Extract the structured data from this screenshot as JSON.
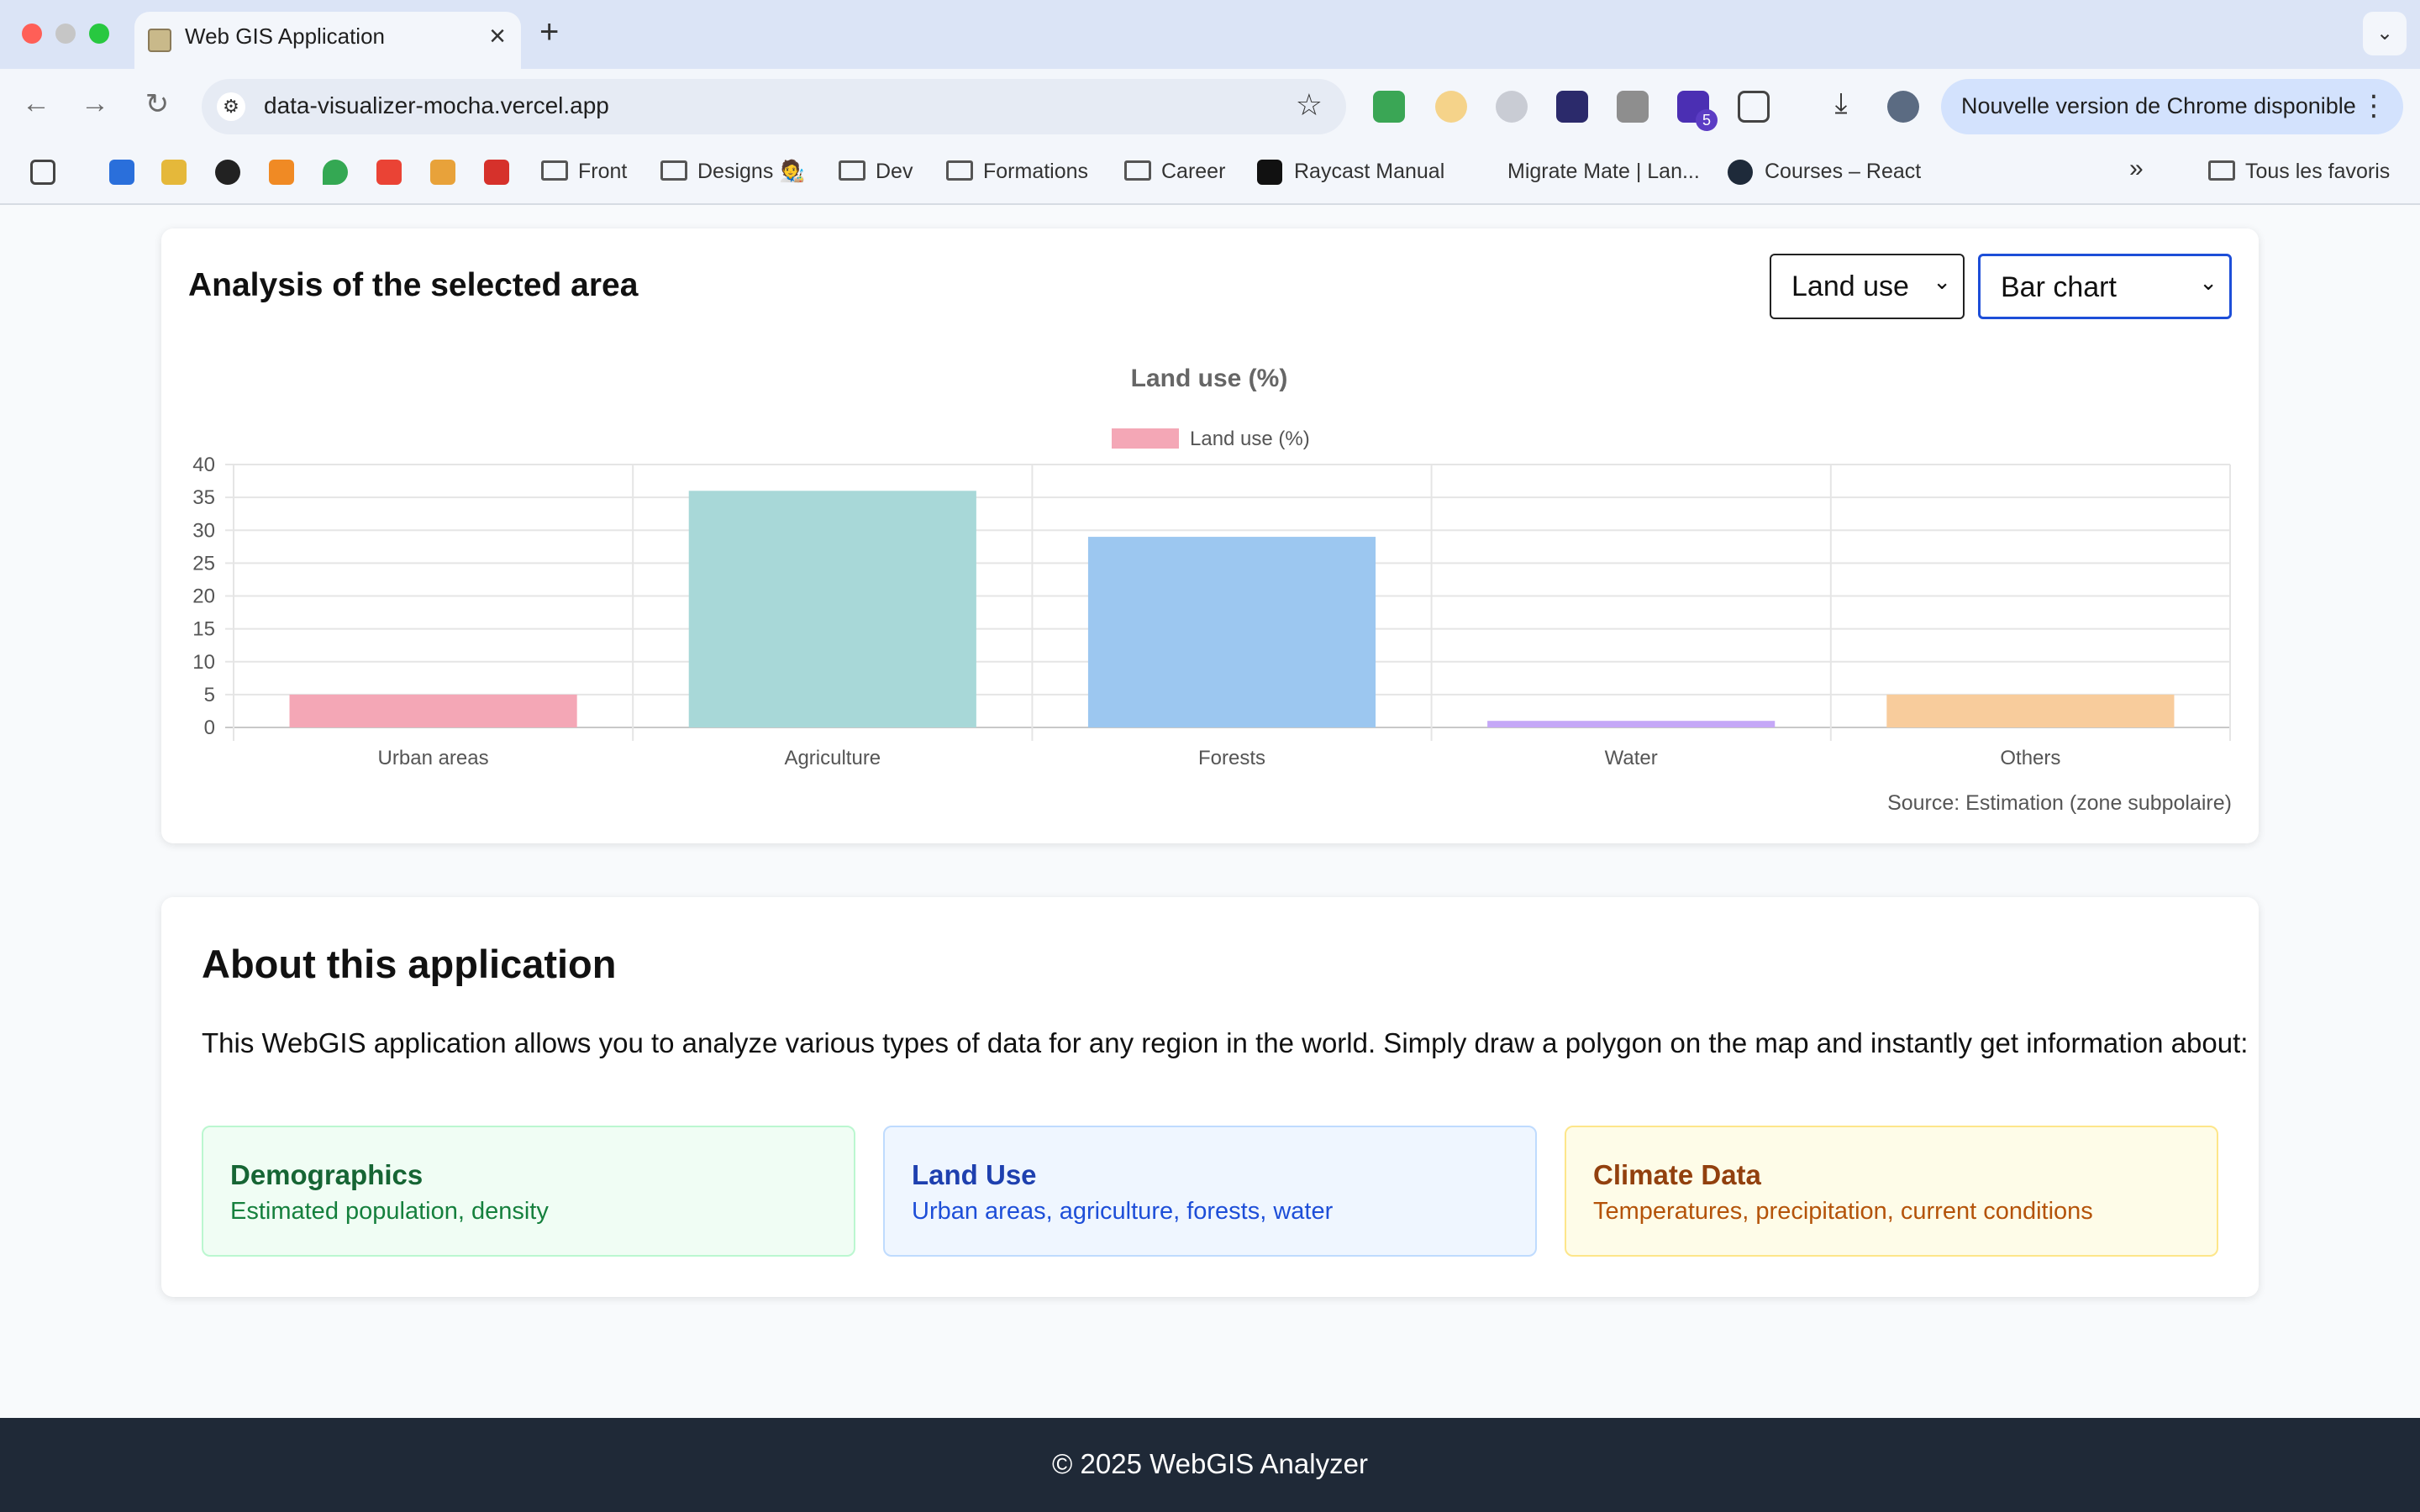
{
  "browser": {
    "tab_title": "Web GIS Application",
    "url": "data-visualizer-mocha.vercel.app",
    "update_label": "Nouvelle version de Chrome disponible",
    "extension_badge": "5",
    "bookmarks": [
      {
        "label": "Front"
      },
      {
        "label": "Designs 🧑‍🎨"
      },
      {
        "label": "Dev"
      },
      {
        "label": "Formations"
      },
      {
        "label": "Career"
      },
      {
        "label": "Raycast Manual"
      },
      {
        "label": "Migrate Mate | Lan..."
      },
      {
        "label": "Courses – React"
      }
    ],
    "all_bookmarks": "Tous les favoris"
  },
  "analysis": {
    "title": "Analysis of the selected area",
    "data_select": "Land use",
    "chart_select": "Bar chart",
    "source": "Source: Estimation (zone subpolaire)"
  },
  "chart_data": {
    "type": "bar",
    "title": "Land use (%)",
    "categories": [
      "Urban areas",
      "Agriculture",
      "Forests",
      "Water",
      "Others"
    ],
    "series": [
      {
        "name": "Land use (%)",
        "values": [
          5,
          36,
          29,
          1,
          5
        ]
      }
    ],
    "colors": [
      "#f4a7b6",
      "#a8d8d8",
      "#9cc7f0",
      "#c5a8f7",
      "#f8cc9c"
    ],
    "yticks": [
      0,
      5,
      10,
      15,
      20,
      25,
      30,
      35,
      40
    ],
    "ylim": [
      0,
      40
    ],
    "legend": "top",
    "grid": true
  },
  "about": {
    "title": "About this application",
    "description": "This WebGIS application allows you to analyze various types of data for any region in the world. Simply draw a polygon on the map and instantly get information about:",
    "features": [
      {
        "title": "Demographics",
        "text": "Estimated population, density"
      },
      {
        "title": "Land Use",
        "text": "Urban areas, agriculture, forests, water"
      },
      {
        "title": "Climate Data",
        "text": "Temperatures, precipitation, current conditions"
      }
    ]
  },
  "footer": {
    "text": "© 2025 WebGIS Analyzer"
  }
}
